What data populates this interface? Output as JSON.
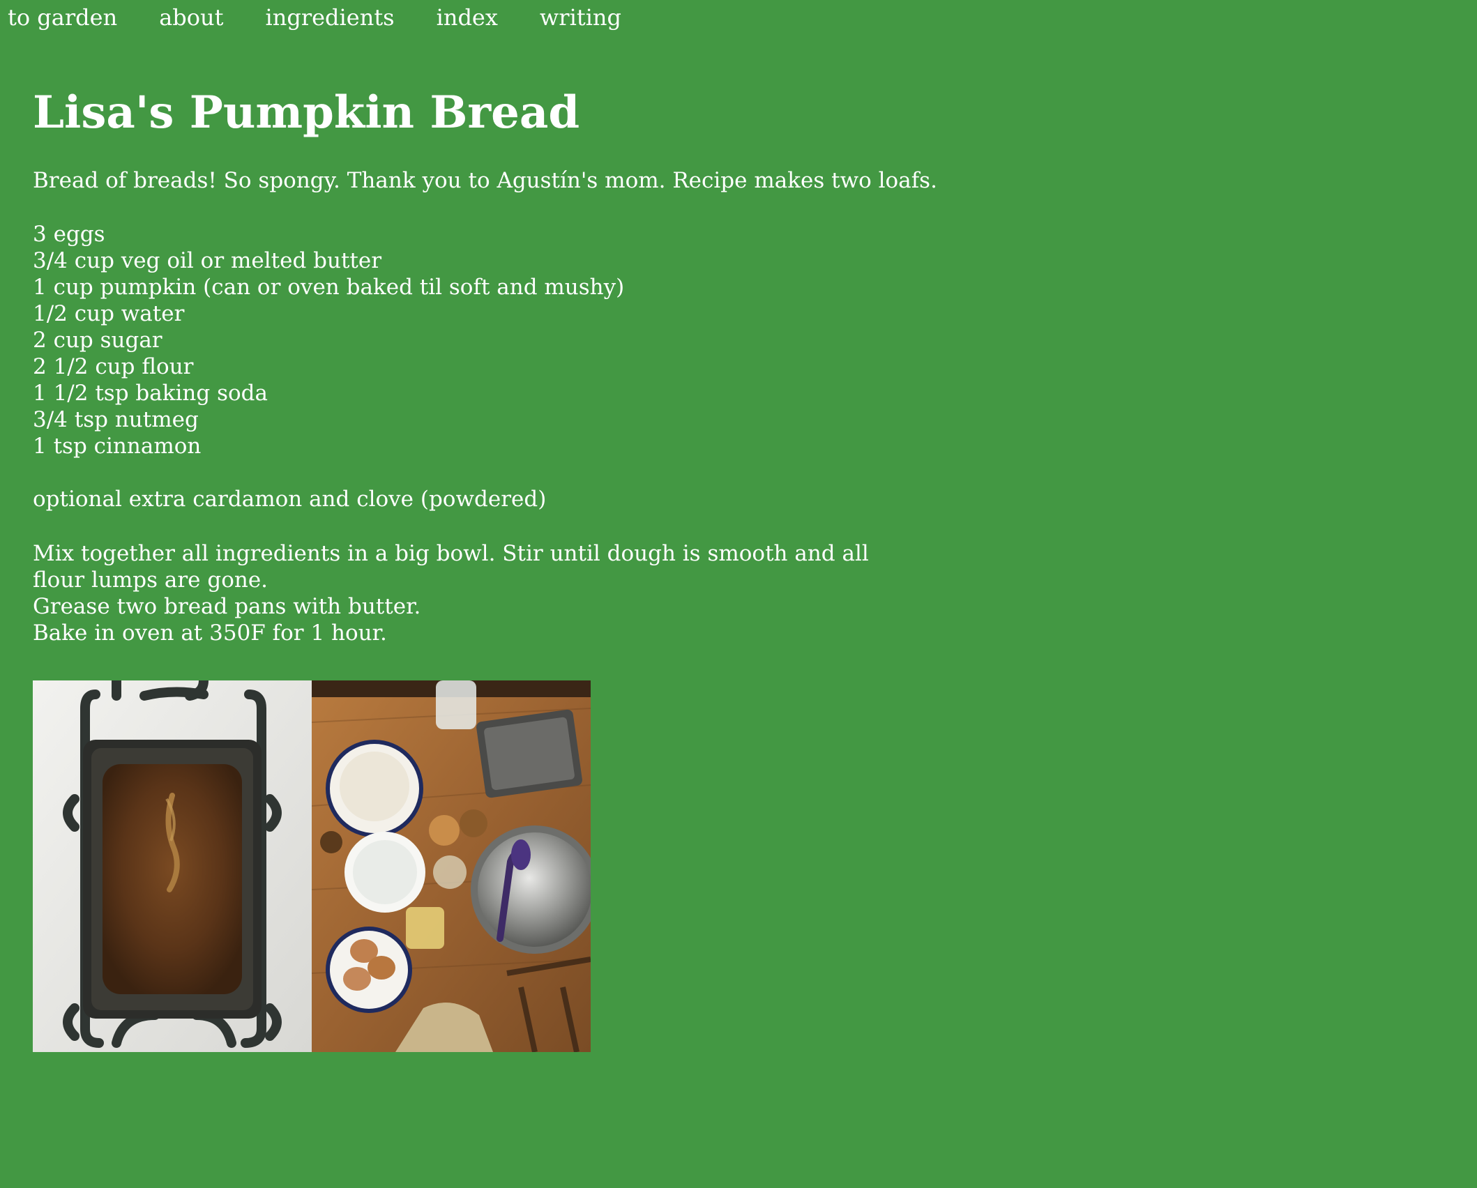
{
  "nav": {
    "items": [
      {
        "label": "to garden"
      },
      {
        "label": "about"
      },
      {
        "label": "ingredients"
      },
      {
        "label": "index"
      },
      {
        "label": "writing"
      }
    ]
  },
  "recipe": {
    "title": "Lisa's Pumpkin Bread",
    "intro": "Bread of breads! So spongy. Thank you to Agustín's mom. Recipe makes two loafs.",
    "ingredients": [
      "3 eggs",
      "3/4 cup veg oil or melted butter",
      "1 cup pumpkin (can or oven baked til soft and mushy)",
      "1/2 cup water",
      "2 cup sugar",
      "2 1/2 cup flour",
      "1 1/2 tsp baking soda",
      "3/4 tsp nutmeg",
      "1 tsp cinnamon"
    ],
    "optional": "optional extra cardamon and clove (powdered)",
    "steps": [
      "Mix together all ingredients in a big bowl. Stir until dough is smooth and all flour lumps are gone.",
      "Grease two bread pans with butter.",
      "Bake in oven at 350F for 1 hour."
    ]
  },
  "colors": {
    "background": "#439843",
    "text": "#ffffff"
  }
}
